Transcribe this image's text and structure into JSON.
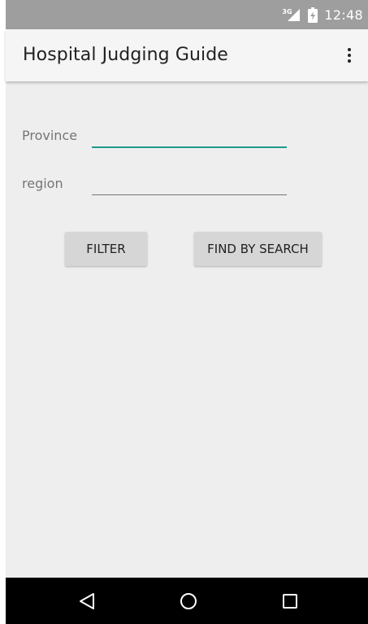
{
  "status_bar": {
    "network_type": "3G",
    "time": "12:48",
    "icons": [
      "signal-icon",
      "battery-icon"
    ]
  },
  "app_bar": {
    "title": "Hospital Judging Guide",
    "menu_icon": "overflow-menu-icon"
  },
  "form": {
    "province_label": "Province",
    "province_value": "",
    "region_label": "region",
    "region_value": ""
  },
  "buttons": {
    "filter_label": "FILTER",
    "search_label": "FIND BY SEARCH"
  },
  "nav_bar": {
    "icons": [
      "back-icon",
      "home-icon",
      "recents-icon"
    ]
  },
  "colors": {
    "accent": "#1d9a8c",
    "status_bar": "#9e9e9e",
    "app_bar": "#f5f5f5",
    "background": "#eeeeee",
    "button": "#d6d6d6",
    "nav_bar": "#000000"
  }
}
